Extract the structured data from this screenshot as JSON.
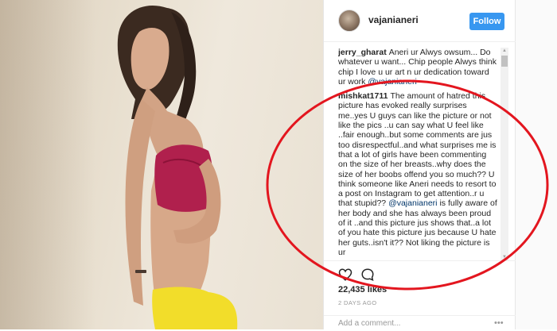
{
  "post": {
    "username": "vajanianeri",
    "follow_label": "Follow"
  },
  "comments": [
    {
      "user": "jerry_gharat",
      "text": "Aneri ur Alwys owsum... Do whatever u want... Chip people Alwys think chip I love u ur art n ur dedication toward ur work",
      "mention": "@vajanianeri"
    },
    {
      "user": "mishkat1711",
      "text_before_mention": "The amount of hatred this picture has evoked really surprises me..yes U guys can like the picture or not like the pics ..u can say what U feel like ..fair enough..but some comments are jus too disrespectful..and what surprises me is that a lot of girls have been commenting on the size of her breasts..why does the size of her boobs offend you so much?? U think someone like Aneri needs to resort to a post on Instagram to get attention..r u that stupid??",
      "mention": "@vajanianeri",
      "text_after_mention": "is fully aware of her body and she has always been proud of it ..and this picture jus shows that..a lot of you hate this picture jus because U hate her guts..isn't it?? Not liking the picture is ur"
    }
  ],
  "actions": {
    "like_icon": "heart-icon",
    "comment_icon": "comment-bubble-icon"
  },
  "likes": "22,435 likes",
  "timestamp": "2 DAYS AGO",
  "add_comment": {
    "placeholder": "Add a comment...",
    "more_icon": "more-dots-icon"
  },
  "colors": {
    "follow_button": "#3897f0",
    "annotation_ellipse": "#e3161f",
    "text": "#262626"
  }
}
